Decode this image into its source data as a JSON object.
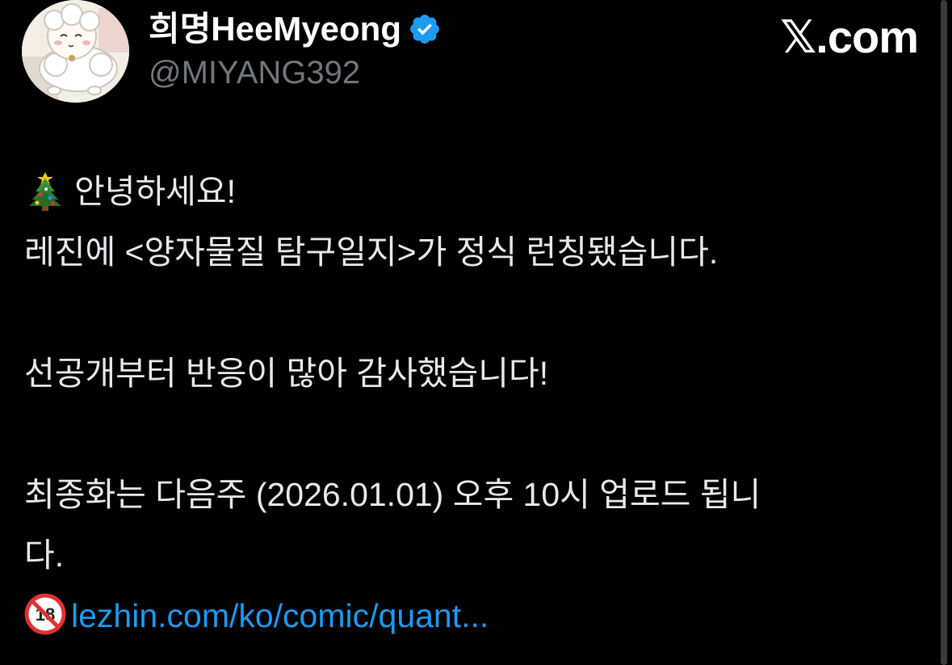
{
  "author": {
    "display_name": "희명HeeMyeong",
    "handle": "@MIYANG392",
    "verified_icon": "verified-badge-icon",
    "avatar": "sheep-avatar"
  },
  "site": {
    "label": "𝕏.com"
  },
  "post": {
    "line1_emoji": "christmas-tree-icon",
    "line1": "안녕하세요!",
    "line2": "레진에 <양자물질 탐구일지>가 정식 런칭됐습니다.",
    "line3": "선공개부터 반응이 많아 감사했습니다!",
    "line4": "최종화는 다음주 (2026.01.01) 오후 10시 업로드 됩니",
    "line5": "다.",
    "link_emoji": "no-one-under-eighteen-icon",
    "link_text": "lezhin.com/ko/comic/quant..."
  },
  "colors": {
    "background": "#000000",
    "text": "#e7e9ea",
    "handle": "#71767b",
    "link": "#1d9bf0",
    "verified": "#1d9bf0"
  }
}
